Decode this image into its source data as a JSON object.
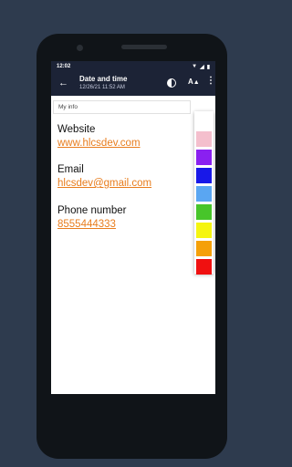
{
  "status_bar": {
    "time": "12:02"
  },
  "app_bar": {
    "title": "Date and time",
    "subtitle": "12/26/21    11:52 AM",
    "text_size_label": "A"
  },
  "content": {
    "info_label": "My info",
    "fields": [
      {
        "label": "Website",
        "value": "www.hlcsdev.com"
      },
      {
        "label": "Email",
        "value": "hlcsdev@gmail.com"
      },
      {
        "label": "Phone number",
        "value": "8555444333"
      }
    ]
  },
  "palette": {
    "colors": [
      "#ffffff",
      "#f4bfcd",
      "#8a20f0",
      "#1818e8",
      "#5aa6f2",
      "#47c52a",
      "#f5f510",
      "#f5a008",
      "#f01010"
    ]
  },
  "icons": [
    "back-icon",
    "brightness-icon",
    "text-size-icon",
    "more-vert-icon"
  ]
}
